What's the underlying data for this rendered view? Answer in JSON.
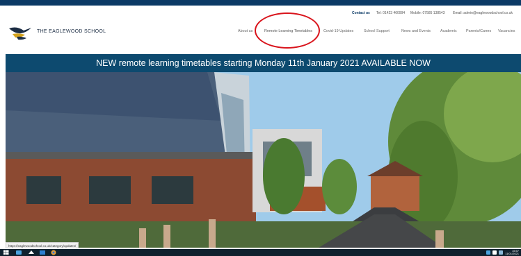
{
  "contact": {
    "label": "Contact us",
    "tel": "Tel: 01423 460994",
    "mobile": "Mobile: 07585 138543",
    "email": "Email: admin@eaglewoodschool.co.uk"
  },
  "header": {
    "school_name": "THE EAGLEWOOD SCHOOL",
    "nav": [
      "About us",
      "Remote Learning Timetables",
      "Covid-19 Updates",
      "School Support",
      "News and Events",
      "Academic",
      "Parents/Carers",
      "Vacancies"
    ]
  },
  "banner": {
    "text": "NEW remote learning timetables starting Monday 11th January 2021 AVAILABLE NOW"
  },
  "status_bar": {
    "url": "https://eaglewoodschool.co.uk/category/updates/"
  },
  "taskbar": {
    "clock_time": "15:57",
    "clock_date": "11/01/2021"
  },
  "colors": {
    "brand": "#0b3a66",
    "banner": "#0d4a6f",
    "annotation": "#d9141c",
    "taskbar": "#10212e"
  }
}
